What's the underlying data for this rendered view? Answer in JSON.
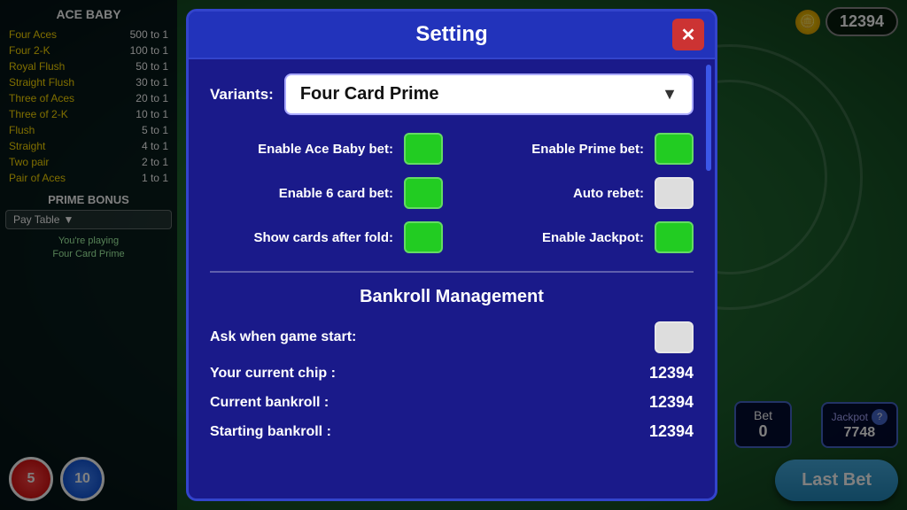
{
  "game": {
    "title": "Four Card Prime",
    "chip_count": "12394"
  },
  "left_panel": {
    "ace_baby_title": "ACE BABY",
    "pay_table": [
      {
        "hand": "Four Aces",
        "odds": "500 to 1"
      },
      {
        "hand": "Four 2-K",
        "odds": "100 to 1"
      },
      {
        "hand": "Royal Flush",
        "odds": "50 to 1"
      },
      {
        "hand": "Straight Flush",
        "odds": "30 to 1"
      },
      {
        "hand": "Three of Aces",
        "odds": "20 to 1"
      },
      {
        "hand": "Three of 2-K",
        "odds": "10 to 1"
      },
      {
        "hand": "Flush",
        "odds": "5 to 1"
      },
      {
        "hand": "Straight",
        "odds": "4 to 1"
      },
      {
        "hand": "Two pair",
        "odds": "2 to 1"
      },
      {
        "hand": "Pair of Aces",
        "odds": "1 to 1"
      }
    ],
    "prime_bonus_title": "PRIME BONUS",
    "pay_table_btn": "Pay Table",
    "playing_line1": "You're playing",
    "playing_line2": "Four Card Prime"
  },
  "chips": [
    {
      "value": "5",
      "color": "red"
    },
    {
      "value": "10",
      "color": "blue"
    }
  ],
  "jackpot": {
    "label": "Jackpot",
    "value": "7748",
    "help": "?"
  },
  "bet": {
    "label": "Bet",
    "value": "0"
  },
  "last_bet_btn": "Last Bet",
  "modal": {
    "title": "Setting",
    "close_btn": "✕",
    "variants_label": "Variants:",
    "variants_value": "Four Card Prime",
    "toggles": [
      {
        "label": "Enable Ace Baby bet:",
        "state": "on",
        "id": "ace-baby-bet"
      },
      {
        "label": "Enable Prime bet:",
        "state": "on",
        "id": "prime-bet"
      },
      {
        "label": "Enable 6 card bet:",
        "state": "on",
        "id": "six-card-bet"
      },
      {
        "label": "Auto rebet:",
        "state": "off",
        "id": "auto-rebet"
      },
      {
        "label": "Show cards after fold:",
        "state": "on",
        "id": "show-cards"
      },
      {
        "label": "Enable Jackpot:",
        "state": "on",
        "id": "enable-jackpot"
      }
    ],
    "bankroll": {
      "title": "Bankroll Management",
      "ask_label": "Ask when game start:",
      "ask_state": "off",
      "current_chip_label": "Your current chip :",
      "current_chip_value": "12394",
      "current_bankroll_label": "Current bankroll   :",
      "current_bankroll_value": "12394",
      "starting_bankroll_label": "Starting bankroll  :",
      "starting_bankroll_value": "12394"
    }
  }
}
